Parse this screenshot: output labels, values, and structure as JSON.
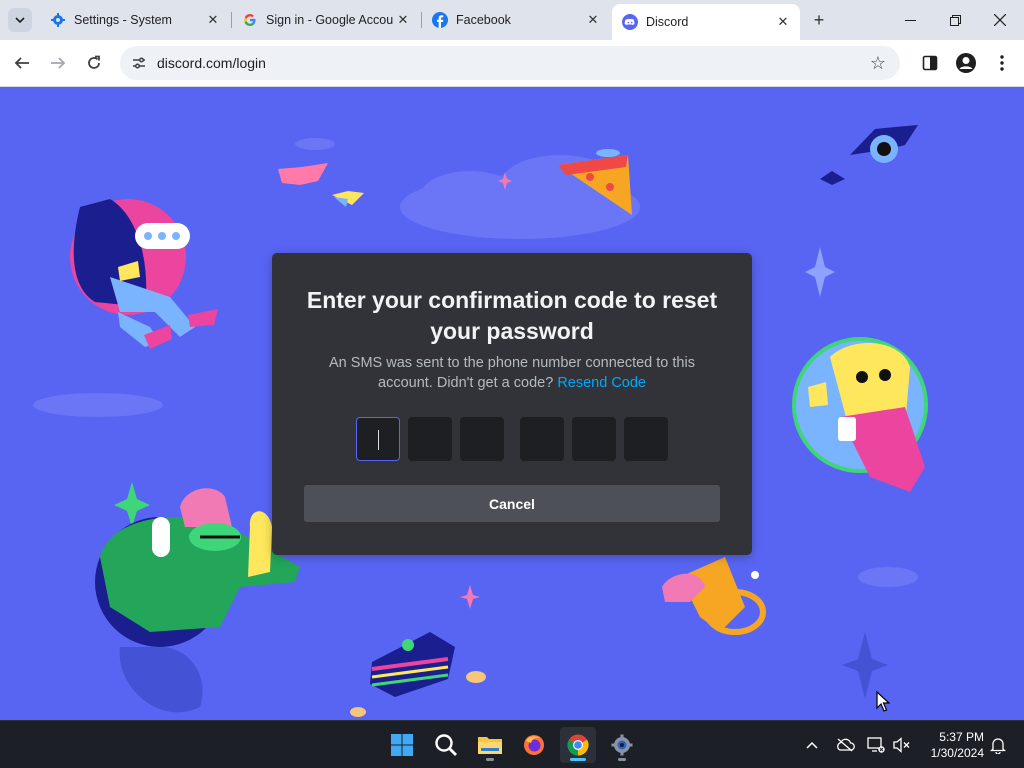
{
  "browser": {
    "tabs": [
      {
        "title": "Settings - System",
        "icon": "gear-icon"
      },
      {
        "title": "Sign in - Google Accou",
        "icon": "google-icon"
      },
      {
        "title": "Facebook",
        "icon": "facebook-icon"
      },
      {
        "title": "Discord",
        "icon": "discord-icon",
        "active": true
      }
    ],
    "new_tab": "+",
    "url": "discord.com/login"
  },
  "modal": {
    "title": "Enter your confirmation code to reset your password",
    "description": "An SMS was sent to the phone number connected to this account. Didn't get a code?",
    "resend_link": "Resend Code",
    "cancel_label": "Cancel",
    "code_length": 6
  },
  "taskbar": {
    "time": "5:37 PM",
    "date": "1/30/2024",
    "apps": [
      "start-icon",
      "search-icon",
      "file-explorer-icon",
      "firefox-icon",
      "chrome-icon",
      "settings-icon"
    ]
  },
  "colors": {
    "blurple": "#5865f2",
    "modal_bg": "#313338",
    "link": "#00a8fc",
    "button": "#4e5058"
  }
}
